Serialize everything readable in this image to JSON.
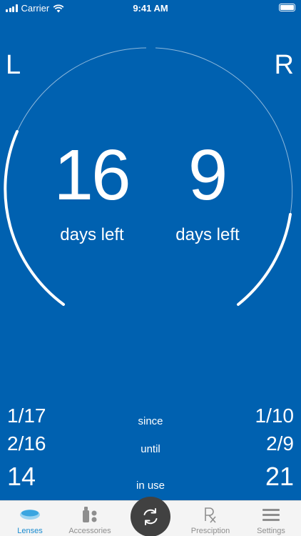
{
  "status_bar": {
    "carrier": "Carrier",
    "time": "9:41 AM"
  },
  "sides": {
    "left": "L",
    "right": "R"
  },
  "left_eye": {
    "days_left": "16",
    "days_label": "days left",
    "since": "1/17",
    "until": "2/16",
    "in_use": "14"
  },
  "right_eye": {
    "days_left": "9",
    "days_label": "days left",
    "since": "1/10",
    "until": "2/9",
    "in_use": "21"
  },
  "labels": {
    "since": "since",
    "until": "until",
    "in_use": "in use"
  },
  "tabs": [
    {
      "label": "Lenses",
      "icon": "lens-icon",
      "active": true
    },
    {
      "label": "Accessories",
      "icon": "accessories-icon",
      "active": false
    },
    {
      "label": "",
      "icon": "swap-icon",
      "active": false
    },
    {
      "label": "Presciption",
      "icon": "rx-icon",
      "active": false
    },
    {
      "label": "Settings",
      "icon": "menu-icon",
      "active": false
    }
  ],
  "colors": {
    "background": "#0061B0",
    "tab_bar": "#F4F4F4",
    "active_tab": "#1A8BD0",
    "center_button": "#414141"
  }
}
